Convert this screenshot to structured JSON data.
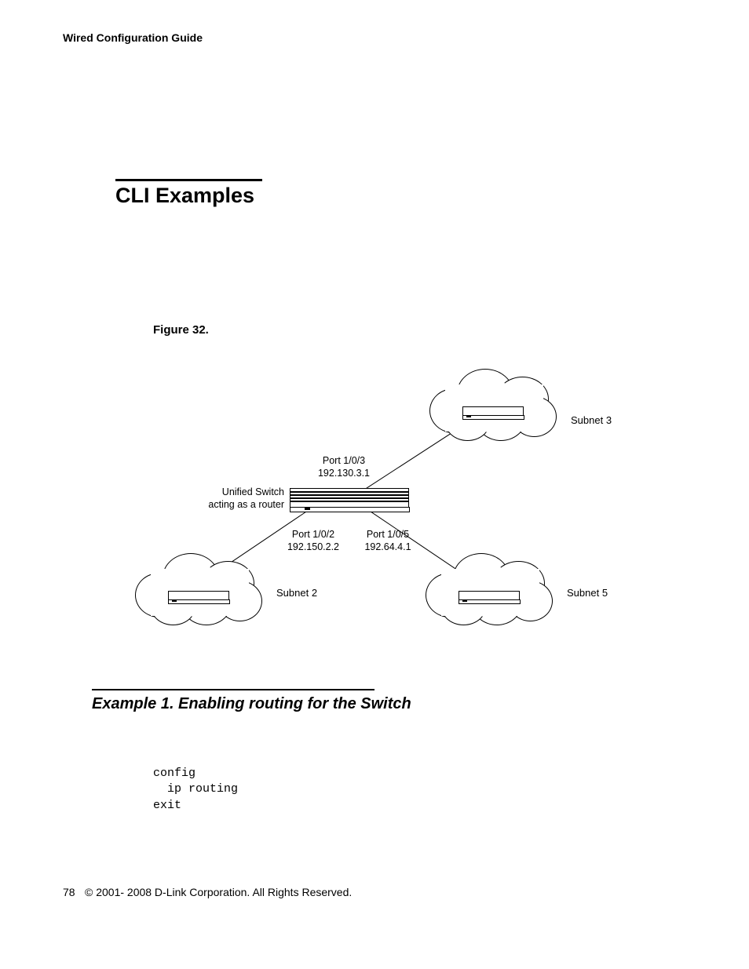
{
  "header": {
    "running": "Wired Configuration Guide"
  },
  "section": {
    "title": "CLI Examples"
  },
  "figure": {
    "caption": "Figure 32.",
    "router_label_1": "Unified Switch",
    "router_label_2": "acting as a router",
    "port3_line1": "Port 1/0/3",
    "port3_line2": "192.130.3.1",
    "port2_line1": "Port 1/0/2",
    "port2_line2": "192.150.2.2",
    "port5_line1": "Port 1/0/5",
    "port5_line2": "192.64.4.1",
    "subnet3": "Subnet  3",
    "subnet2": "Subnet  2",
    "subnet5": "Subnet  5"
  },
  "example": {
    "title": "Example 1. Enabling routing for the Switch",
    "code": "config\n  ip routing\nexit"
  },
  "footer": {
    "page": "78",
    "copyright": "© 2001- 2008 D-Link Corporation. All Rights Reserved."
  }
}
